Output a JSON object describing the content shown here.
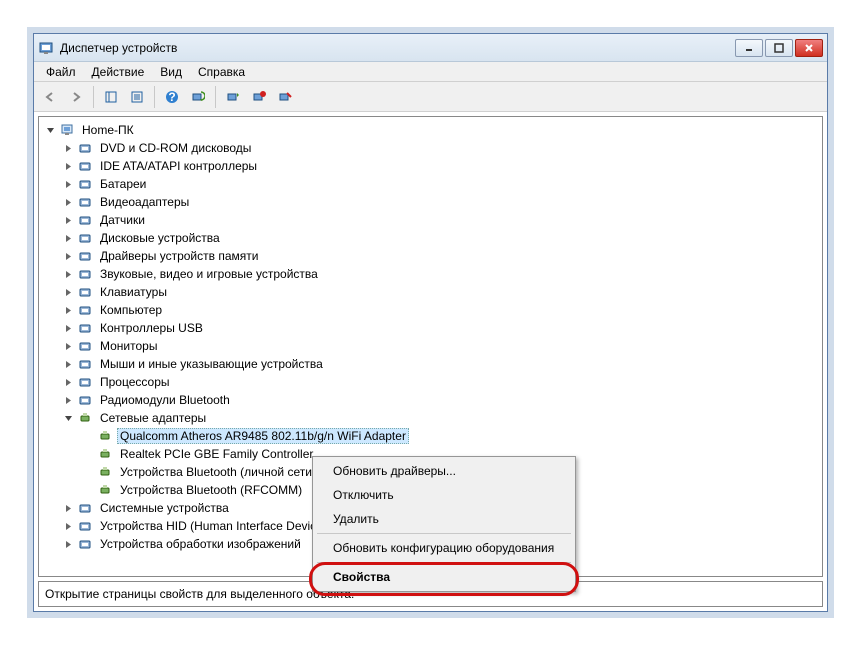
{
  "window": {
    "title": "Диспетчер устройств"
  },
  "menu": {
    "file": "Файл",
    "action": "Действие",
    "view": "Вид",
    "help": "Справка"
  },
  "tree": {
    "root": "Home-ПК",
    "items": [
      "DVD и CD-ROM дисководы",
      "IDE ATA/ATAPI контроллеры",
      "Батареи",
      "Видеоадаптеры",
      "Датчики",
      "Дисковые устройства",
      "Драйверы устройств памяти",
      "Звуковые, видео и игровые устройства",
      "Клавиатуры",
      "Компьютер",
      "Контроллеры USB",
      "Мониторы",
      "Мыши и иные указывающие устройства",
      "Процессоры",
      "Радиомодули Bluetooth"
    ],
    "network": "Сетевые адаптеры",
    "net_children": [
      "Qualcomm Atheros AR9485 802.11b/g/n WiFi Adapter",
      "Realtek PCIe GBE Family Controller",
      "Устройства Bluetooth (личной сети)",
      "Устройства Bluetooth (RFCOMM)"
    ],
    "tail": [
      "Системные устройства",
      "Устройства HID (Human Interface Devices)",
      "Устройства обработки изображений"
    ]
  },
  "context": {
    "update": "Обновить драйверы...",
    "disable": "Отключить",
    "delete": "Удалить",
    "scan": "Обновить конфигурацию оборудования",
    "props": "Свойства"
  },
  "status": "Открытие страницы свойств для выделенного объекта."
}
